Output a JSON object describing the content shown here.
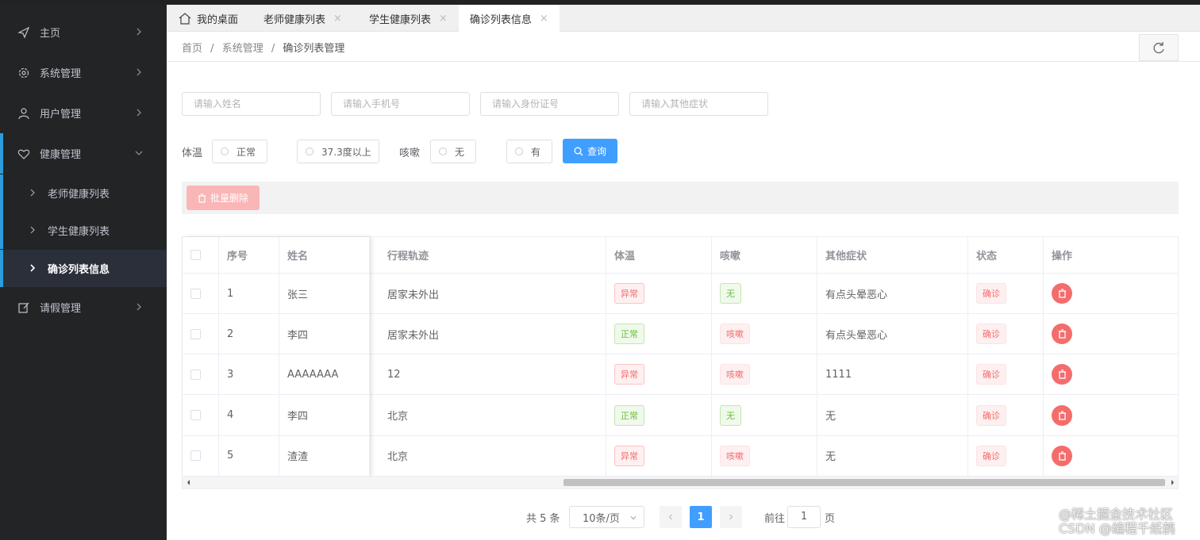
{
  "sidebar": {
    "items": [
      {
        "label": "主页",
        "icon": "paper-plane-icon"
      },
      {
        "label": "系统管理",
        "icon": "gear-icon"
      },
      {
        "label": "用户管理",
        "icon": "user-icon"
      },
      {
        "label": "健康管理",
        "icon": "heart-icon"
      },
      {
        "label": "请假管理",
        "icon": "edit-icon"
      }
    ],
    "sub_items": [
      {
        "label": "老师健康列表"
      },
      {
        "label": "学生健康列表"
      },
      {
        "label": "确诊列表信息"
      }
    ]
  },
  "tabs": [
    {
      "label": "我的桌面"
    },
    {
      "label": "老师健康列表"
    },
    {
      "label": "学生健康列表"
    },
    {
      "label": "确诊列表信息"
    }
  ],
  "tab_close": "×",
  "breadcrumb": {
    "items": [
      "首页",
      "系统管理",
      "确诊列表管理"
    ],
    "sep": "/"
  },
  "search": {
    "name_placeholder": "请输入姓名",
    "phone_placeholder": "请输入手机号",
    "id_placeholder": "请输入身份证号",
    "symptom_placeholder": "请输入其他症状",
    "temp_label": "体温",
    "temp_normal": "正常",
    "temp_high": "37.3度以上",
    "cough_label": "咳嗽",
    "cough_no": "无",
    "cough_yes": "有",
    "query_button": "查询"
  },
  "toolbar": {
    "batch_delete": "批量删除"
  },
  "table": {
    "headers": [
      "序号",
      "姓名",
      "行程轨迹",
      "体温",
      "咳嗽",
      "其他症状",
      "状态",
      "操作"
    ],
    "rows": [
      {
        "no": "1",
        "name": "张三",
        "trip": "居家未外出",
        "temp": "异常",
        "cough": "无",
        "other": "有点头晕恶心",
        "status": "确诊"
      },
      {
        "no": "2",
        "name": "李四",
        "trip": "居家未外出",
        "temp": "正常",
        "cough": "咳嗽",
        "other": "有点头晕恶心",
        "status": "确诊"
      },
      {
        "no": "3",
        "name": "AAAAAAA",
        "trip": "12",
        "temp": "异常",
        "cough": "咳嗽",
        "other": "1111",
        "status": "确诊"
      },
      {
        "no": "4",
        "name": "李四",
        "trip": "北京",
        "temp": "正常",
        "cough": "无",
        "other": "无",
        "status": "确诊"
      },
      {
        "no": "5",
        "name": "渣渣",
        "trip": "北京",
        "temp": "异常",
        "cough": "咳嗽",
        "other": "无",
        "status": "确诊"
      }
    ]
  },
  "pagination": {
    "total_text": "共 5 条",
    "page_size": "10条/页",
    "current_page": "1",
    "goto_label": "前往",
    "goto_value": "1",
    "page_unit": "页"
  },
  "watermark": {
    "line1": "@稀土掘金技术社区",
    "line2": "CSDN @编程千纸鹤"
  },
  "colors": {
    "primary": "#409eff",
    "danger": "#f56c6c",
    "success": "#67c23a",
    "sidebar_bg": "#222426",
    "accent": "#2d9cdb"
  }
}
